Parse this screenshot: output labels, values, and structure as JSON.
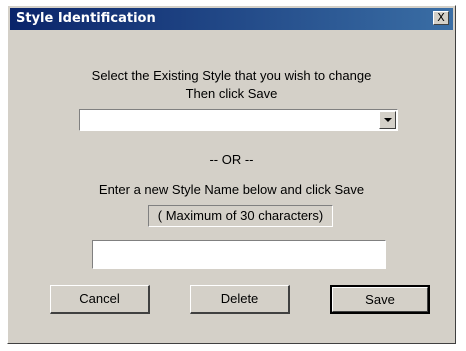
{
  "window": {
    "title": "Style Identification",
    "close_label": "X"
  },
  "instructions": {
    "line1": "Select the Existing Style that you wish to change",
    "line2": "Then click Save"
  },
  "existing_style_select": {
    "selected_value": ""
  },
  "separator_text": "-- OR --",
  "new_style": {
    "prompt": "Enter a new Style Name below and click Save",
    "limit_note": "( Maximum of 30 characters)",
    "value": ""
  },
  "buttons": {
    "cancel": "Cancel",
    "delete": "Delete",
    "save": "Save"
  }
}
